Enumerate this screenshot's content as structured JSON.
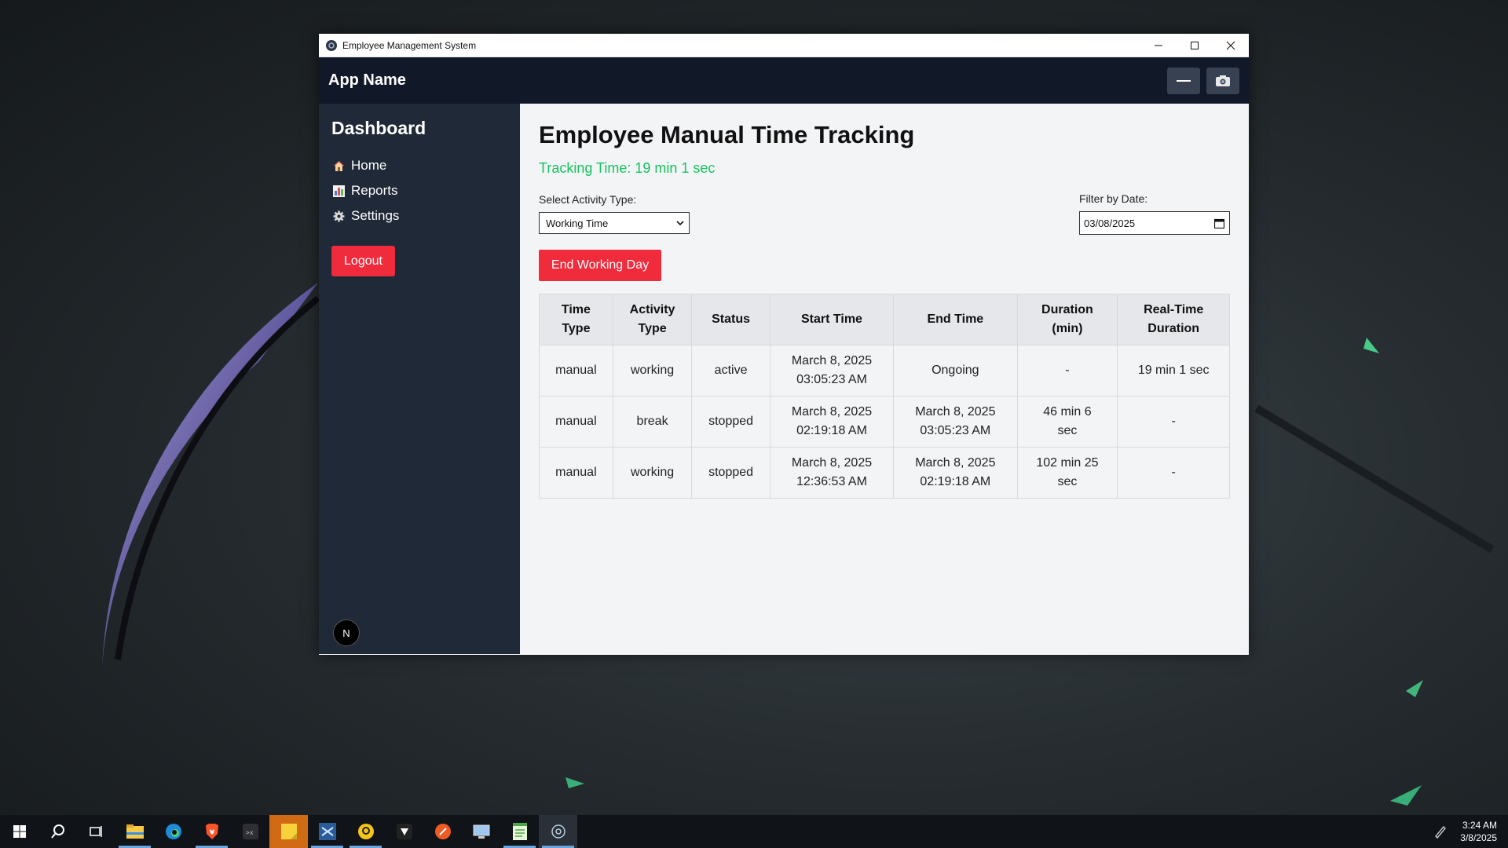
{
  "window": {
    "title": "Employee Management System",
    "buttons": [
      "minimize",
      "maximize",
      "close"
    ]
  },
  "appbar": {
    "app_name": "App Name",
    "buttons": [
      {
        "icon": "minus-icon"
      },
      {
        "icon": "camera-icon"
      }
    ]
  },
  "sidebar": {
    "heading": "Dashboard",
    "items": [
      {
        "label": "Home",
        "icon": "home-icon"
      },
      {
        "label": "Reports",
        "icon": "bar-chart-icon"
      },
      {
        "label": "Settings",
        "icon": "gear-icon"
      }
    ],
    "logout_label": "Logout",
    "badge": "N"
  },
  "main": {
    "title": "Employee Manual Time Tracking",
    "tracking_time": "Tracking Time: 19 min 1 sec",
    "activity_label": "Select Activity Type:",
    "activity_value": "Working Time",
    "date_label": "Filter by Date:",
    "date_value": "03/08/2025",
    "end_day_label": "End Working Day",
    "table": {
      "headers": [
        [
          "Time",
          "Type"
        ],
        [
          "Activity",
          "Type"
        ],
        [
          "Status"
        ],
        [
          "Start Time"
        ],
        [
          "End Time"
        ],
        [
          "Duration",
          "(min)"
        ],
        [
          "Real-Time",
          "Duration"
        ]
      ],
      "rows": [
        [
          [
            "manual"
          ],
          [
            "working"
          ],
          [
            "active"
          ],
          [
            "March 8, 2025",
            "03:05:23 AM"
          ],
          [
            "Ongoing"
          ],
          [
            "-"
          ],
          [
            "19 min 1 sec"
          ]
        ],
        [
          [
            "manual"
          ],
          [
            "break"
          ],
          [
            "stopped"
          ],
          [
            "March 8, 2025",
            "02:19:18 AM"
          ],
          [
            "March 8, 2025",
            "03:05:23 AM"
          ],
          [
            "46 min 6",
            "sec"
          ],
          [
            "-"
          ]
        ],
        [
          [
            "manual"
          ],
          [
            "working"
          ],
          [
            "stopped"
          ],
          [
            "March 8, 2025",
            "12:36:53 AM"
          ],
          [
            "March 8, 2025",
            "02:19:18 AM"
          ],
          [
            "102 min 25",
            "sec"
          ],
          [
            "-"
          ]
        ]
      ]
    }
  },
  "taskbar": {
    "apps": [
      "windows-start-icon",
      "search-icon",
      "task-view-icon",
      "file-explorer-icon",
      "edge-icon",
      "brave-icon",
      "app-icon",
      "sticky-notes-icon",
      "vscode-icon",
      "app-icon",
      "app-icon",
      "postman-icon",
      "remote-desktop-icon",
      "notepad-icon",
      "electron-app-icon"
    ],
    "time": "3:24 AM",
    "date": "3/8/2025"
  },
  "colors": {
    "accent_red": "#ef2b3c",
    "tracking_green": "#16c25e",
    "sidebar_bg": "#1f2937",
    "appbar_bg": "#111827"
  }
}
